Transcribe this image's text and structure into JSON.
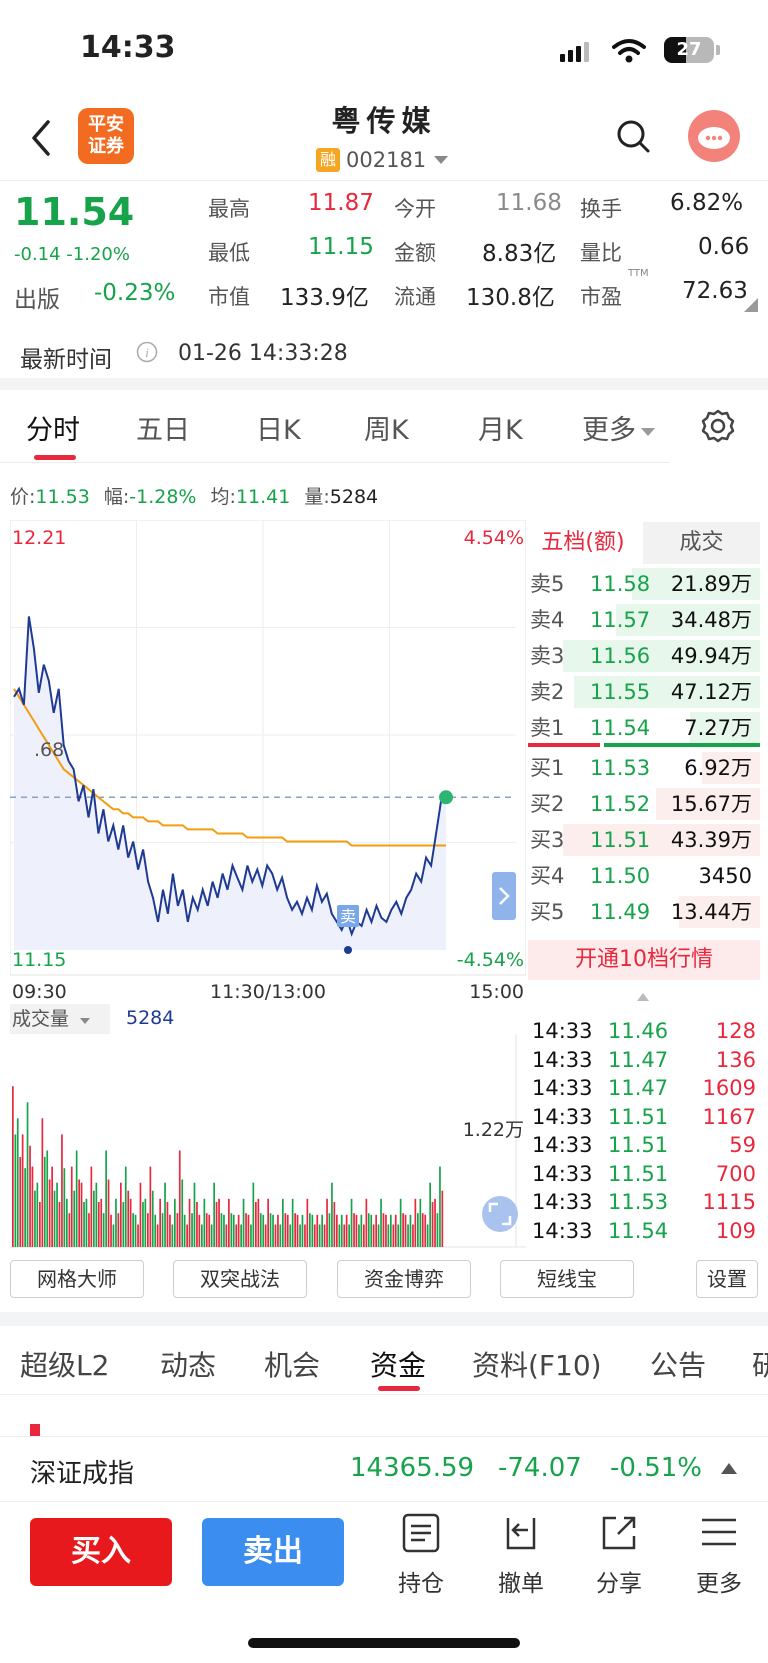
{
  "status": {
    "time": "14:33",
    "battery": "27"
  },
  "header": {
    "logo_line1": "平安",
    "logo_line2": "证券",
    "stock_name": "粤传媒",
    "rong_badge": "融",
    "stock_code": "002181"
  },
  "quote": {
    "price": "11.54",
    "change": "-0.14 -1.20%",
    "sector_label": "出版",
    "sector_change": "-0.23%",
    "high_label": "最高",
    "high": "11.87",
    "low_label": "最低",
    "low": "11.15",
    "mcap_label": "市值",
    "mcap": "133.9亿",
    "open_label": "今开",
    "open": "11.68",
    "amount_label": "金额",
    "amount": "8.83亿",
    "float_label": "流通",
    "float": "130.8亿",
    "turnover_label": "换手",
    "turnover": "6.82%",
    "volratio_label": "量比",
    "volratio": "0.66",
    "pe_label": "市盈",
    "pe_sup": "TTM",
    "pe": "72.63"
  },
  "update": {
    "label": "最新时间",
    "value": "01-26 14:33:28"
  },
  "ktabs": [
    "分时",
    "五日",
    "日K",
    "周K",
    "月K",
    "更多"
  ],
  "infobar": {
    "price_label": "价:",
    "price": "11.53",
    "amp_label": "幅:",
    "amp": "-1.28%",
    "avg_label": "均:",
    "avg": "11.41",
    "vol_label": "量:",
    "vol": "5284"
  },
  "chart_data": {
    "type": "line",
    "y_max_label": "12.21",
    "y_min_label": "11.15",
    "pct_max_label": "4.54%",
    "pct_min_label": "-4.54%",
    "prev_close_partial": ".68",
    "x_labels": [
      "09:30",
      "11:30/13:00",
      "15:00"
    ],
    "ylim": [
      11.15,
      12.21
    ],
    "prev_close": 11.68,
    "sell_marker": "卖",
    "series": [
      {
        "name": "价",
        "color": "#1f3a93",
        "values": [
          11.78,
          11.8,
          11.76,
          11.98,
          11.9,
          11.79,
          11.86,
          11.82,
          11.74,
          11.8,
          11.66,
          11.62,
          11.6,
          11.52,
          11.56,
          11.48,
          11.55,
          11.44,
          11.5,
          11.42,
          11.46,
          11.4,
          11.46,
          11.38,
          11.42,
          11.35,
          11.4,
          11.32,
          11.28,
          11.22,
          11.3,
          11.24,
          11.34,
          11.26,
          11.3,
          11.22,
          11.28,
          11.25,
          11.3,
          11.26,
          11.32,
          11.28,
          11.34,
          11.3,
          11.36,
          11.33,
          11.3,
          11.36,
          11.32,
          11.35,
          11.31,
          11.36,
          11.34,
          11.3,
          11.33,
          11.28,
          11.25,
          11.27,
          11.24,
          11.28,
          11.25,
          11.31,
          11.27,
          11.29,
          11.24,
          11.22,
          11.2,
          11.23,
          11.19,
          11.22,
          11.21,
          11.25,
          11.22,
          11.26,
          11.23,
          11.22,
          11.25,
          11.27,
          11.24,
          11.28,
          11.3,
          11.34,
          11.32,
          11.38,
          11.36,
          11.44,
          11.52,
          11.53
        ]
      },
      {
        "name": "均",
        "color": "#f39c12",
        "values": [
          11.8,
          11.78,
          11.76,
          11.74,
          11.72,
          11.7,
          11.68,
          11.66,
          11.64,
          11.62,
          11.6,
          11.59,
          11.58,
          11.57,
          11.56,
          11.55,
          11.54,
          11.53,
          11.52,
          11.51,
          11.5,
          11.5,
          11.49,
          11.49,
          11.48,
          11.48,
          11.48,
          11.47,
          11.47,
          11.47,
          11.46,
          11.46,
          11.46,
          11.46,
          11.46,
          11.45,
          11.45,
          11.45,
          11.45,
          11.45,
          11.45,
          11.44,
          11.44,
          11.44,
          11.44,
          11.44,
          11.44,
          11.43,
          11.43,
          11.43,
          11.43,
          11.43,
          11.43,
          11.43,
          11.43,
          11.42,
          11.42,
          11.42,
          11.42,
          11.42,
          11.42,
          11.42,
          11.42,
          11.42,
          11.42,
          11.42,
          11.42,
          11.42,
          11.41,
          11.41,
          11.41,
          11.41,
          11.41,
          11.41,
          11.41,
          11.41,
          11.41,
          11.41,
          11.41,
          11.41,
          11.41,
          11.41,
          11.41,
          11.41,
          11.41,
          11.41,
          11.41,
          11.41
        ]
      }
    ]
  },
  "volume": {
    "label": "成交量",
    "value": "5284",
    "scale_label": "1.22万"
  },
  "volume_data": {
    "values": [
      10,
      8,
      7,
      9,
      5,
      4,
      8,
      6,
      5,
      4,
      7,
      3,
      5,
      6,
      4,
      3,
      5,
      4,
      3,
      6,
      2,
      3,
      4,
      5,
      3,
      2,
      4,
      3,
      5,
      2,
      3,
      4,
      2,
      3,
      6,
      2,
      3,
      4,
      2,
      3,
      2,
      4,
      3,
      2,
      3,
      2,
      2,
      3,
      2,
      4,
      3,
      2,
      3,
      2,
      2,
      3,
      2,
      3,
      2,
      2,
      3,
      2,
      2,
      2,
      3,
      4,
      2,
      2,
      2,
      3,
      2,
      2,
      3,
      2,
      2,
      3,
      2,
      2,
      2,
      3,
      2,
      2,
      3,
      3,
      2,
      4,
      3,
      5
    ],
    "max": 12
  },
  "orderbook": {
    "tab_active": "五档(额)",
    "tab_other": "成交",
    "asks": [
      {
        "label": "卖5",
        "price": "11.58",
        "vol": "21.89万"
      },
      {
        "label": "卖4",
        "price": "11.57",
        "vol": "34.48万"
      },
      {
        "label": "卖3",
        "price": "11.56",
        "vol": "49.94万"
      },
      {
        "label": "卖2",
        "price": "11.55",
        "vol": "47.12万"
      },
      {
        "label": "卖1",
        "price": "11.54",
        "vol": "7.27万"
      }
    ],
    "bids": [
      {
        "label": "买1",
        "price": "11.53",
        "vol": "6.92万"
      },
      {
        "label": "买2",
        "price": "11.52",
        "vol": "15.67万"
      },
      {
        "label": "买3",
        "price": "11.51",
        "vol": "43.39万"
      },
      {
        "label": "买4",
        "price": "11.50",
        "vol": "3450"
      },
      {
        "label": "买5",
        "price": "11.49",
        "vol": "13.44万"
      }
    ],
    "open_l10": "开通10档行情"
  },
  "trades": [
    {
      "time": "14:33",
      "price": "11.46",
      "vol": "128"
    },
    {
      "time": "14:33",
      "price": "11.47",
      "vol": "136"
    },
    {
      "time": "14:33",
      "price": "11.47",
      "vol": "1609"
    },
    {
      "time": "14:33",
      "price": "11.51",
      "vol": "1167"
    },
    {
      "time": "14:33",
      "price": "11.51",
      "vol": "59"
    },
    {
      "time": "14:33",
      "price": "11.51",
      "vol": "700"
    },
    {
      "time": "14:33",
      "price": "11.53",
      "vol": "1115"
    },
    {
      "time": "14:33",
      "price": "11.54",
      "vol": "109"
    }
  ],
  "tools": [
    "网格大师",
    "双突战法",
    "资金博弈",
    "短线宝",
    "设置"
  ],
  "bottom_tabs": [
    "超级L2",
    "动态",
    "机会",
    "资金",
    "资料(F10)",
    "公告",
    "研"
  ],
  "index": {
    "name": "深证成指",
    "value": "14365.59",
    "change": "-74.07",
    "pct": "-0.51%"
  },
  "actions": {
    "buy": "买入",
    "sell": "卖出",
    "hold": "持仓",
    "cancel": "撤单",
    "share": "分享",
    "more": "更多"
  }
}
